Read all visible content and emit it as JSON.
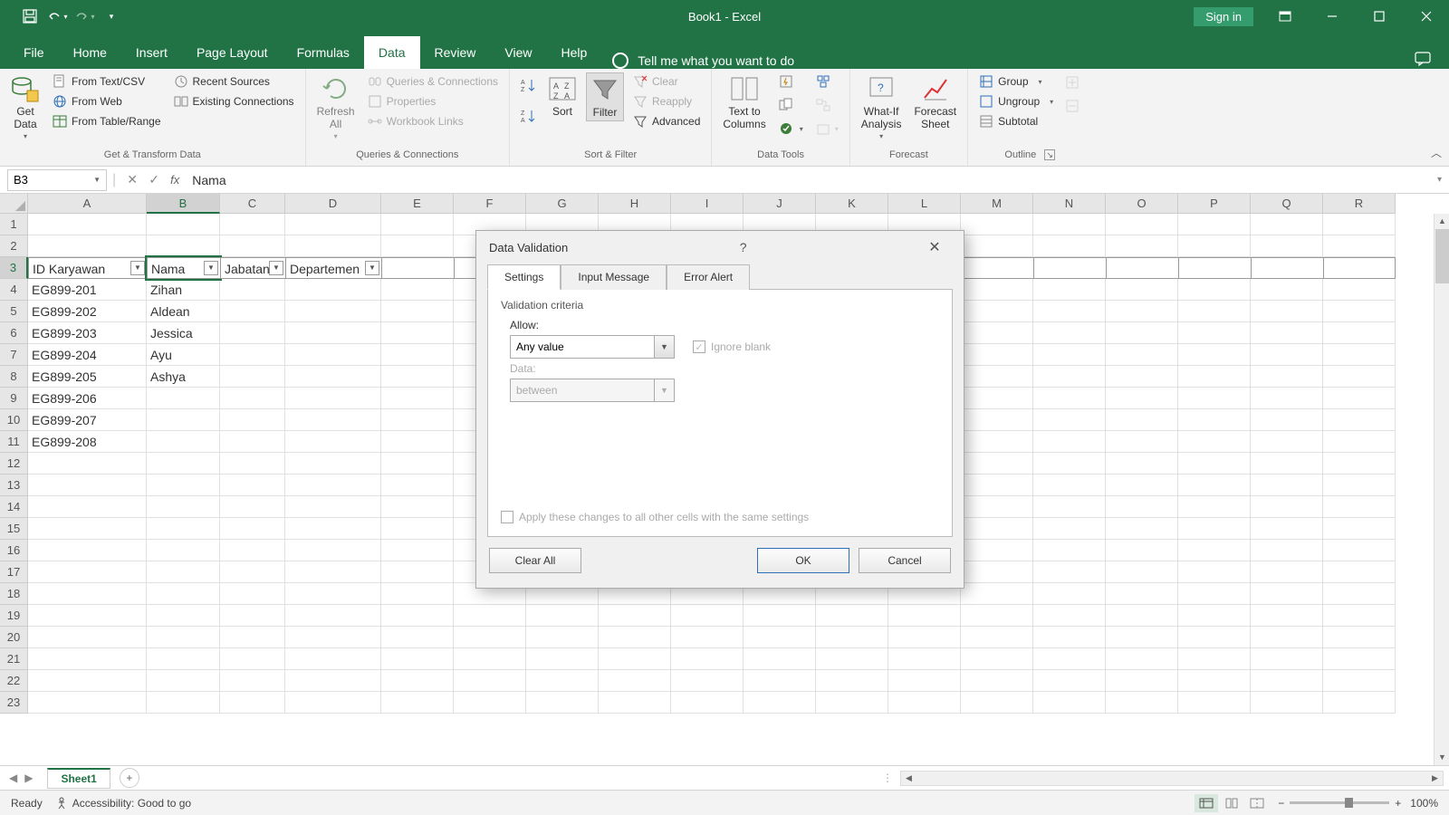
{
  "title_bar": {
    "doc_title": "Book1  -  Excel",
    "sign_in": "Sign in"
  },
  "ribbon_tabs": {
    "file": "File",
    "home": "Home",
    "insert": "Insert",
    "page_layout": "Page Layout",
    "formulas": "Formulas",
    "data": "Data",
    "review": "Review",
    "view": "View",
    "help": "Help",
    "tell_me": "Tell me what you want to do"
  },
  "ribbon": {
    "get_data": "Get\nData",
    "from_text": "From Text/CSV",
    "from_web": "From Web",
    "from_table": "From Table/Range",
    "recent_sources": "Recent Sources",
    "existing_connections": "Existing Connections",
    "group1_label": "Get & Transform Data",
    "refresh": "Refresh\nAll",
    "queries_connections": "Queries & Connections",
    "properties": "Properties",
    "workbook_links": "Workbook Links",
    "group2_label": "Queries & Connections",
    "sort": "Sort",
    "filter": "Filter",
    "clear": "Clear",
    "reapply": "Reapply",
    "advanced": "Advanced",
    "group3_label": "Sort & Filter",
    "text_to_columns": "Text to\nColumns",
    "group4_label": "Data Tools",
    "whatif": "What-If\nAnalysis",
    "forecast_sheet": "Forecast\nSheet",
    "group5_label": "Forecast",
    "group": "Group",
    "ungroup": "Ungroup",
    "subtotal": "Subtotal",
    "group6_label": "Outline"
  },
  "formula_bar": {
    "name_box": "B3",
    "formula": "Nama"
  },
  "grid": {
    "columns": [
      "A",
      "B",
      "C",
      "D",
      "E",
      "F",
      "G",
      "H",
      "I",
      "J",
      "K",
      "L",
      "M",
      "N",
      "O",
      "P",
      "Q",
      "R"
    ],
    "col_widths": {
      "A": 131,
      "B": 81,
      "C": 72,
      "D": 106,
      "default": 80
    },
    "selected_col": "B",
    "selected_row": 3,
    "header_row": [
      "ID Karyawan",
      "Nama",
      "Jabatan",
      "Departemen"
    ],
    "rows": [
      [
        "EG899-201",
        "Zihan",
        "",
        ""
      ],
      [
        "EG899-202",
        "Aldean",
        "",
        ""
      ],
      [
        "EG899-203",
        "Jessica",
        "",
        ""
      ],
      [
        "EG899-204",
        "Ayu",
        "",
        ""
      ],
      [
        "EG899-205",
        "Ashya",
        "",
        ""
      ],
      [
        "EG899-206",
        "",
        "",
        ""
      ],
      [
        "EG899-207",
        "",
        "",
        ""
      ],
      [
        "EG899-208",
        "",
        "",
        ""
      ]
    ],
    "visible_rows": 23
  },
  "sheet_tabs": {
    "active": "Sheet1"
  },
  "status_bar": {
    "ready": "Ready",
    "accessibility": "Accessibility: Good to go",
    "zoom": "100%"
  },
  "dialog": {
    "title": "Data Validation",
    "tabs": [
      "Settings",
      "Input Message",
      "Error Alert"
    ],
    "active_tab": 0,
    "section": "Validation criteria",
    "allow_label": "Allow:",
    "allow_value": "Any value",
    "ignore_blank": "Ignore blank",
    "data_label": "Data:",
    "data_value": "between",
    "apply_all": "Apply these changes to all other cells with the same settings",
    "clear_all": "Clear All",
    "ok": "OK",
    "cancel": "Cancel"
  }
}
